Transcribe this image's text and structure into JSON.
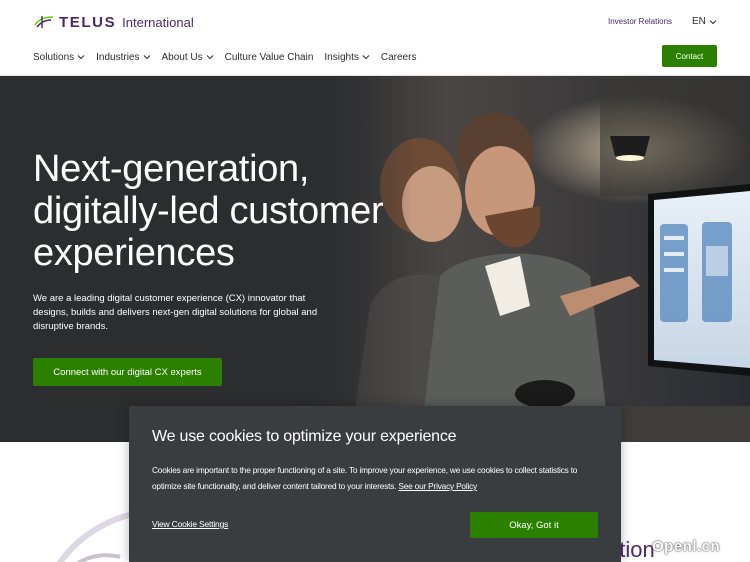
{
  "header": {
    "logo_brand": "TELUS",
    "logo_sub": "International",
    "investor_relations": "Investor Relations",
    "language": "EN",
    "contact_label": "Contact"
  },
  "nav": {
    "items": [
      {
        "label": "Solutions",
        "has_dropdown": true
      },
      {
        "label": "Industries",
        "has_dropdown": true
      },
      {
        "label": "About Us",
        "has_dropdown": true
      },
      {
        "label": "Culture Value Chain",
        "has_dropdown": false
      },
      {
        "label": "Insights",
        "has_dropdown": true
      },
      {
        "label": "Careers",
        "has_dropdown": false
      }
    ]
  },
  "hero": {
    "title_line1": "Next-generation,",
    "title_line2": "digitally-led customer",
    "title_line3": "experiences",
    "description": "We are a leading digital customer experience (CX) innovator that designs, builds and delivers next-gen digital solutions for global and disruptive brands.",
    "cta_label": "Connect with our digital CX experts"
  },
  "below": {
    "partial_heading": "vation"
  },
  "cookie": {
    "title": "We use cookies to optimize your experience",
    "body": "Cookies are important to the proper functioning of a site. To improve your experience, we use cookies to collect statistics to optimize site functionality, and deliver content tailored to your interests.",
    "policy_link": "See our Privacy Policy",
    "settings_label": "View Cookie Settings",
    "accept_label": "Okay, Got it"
  },
  "watermark": "Openl.cn",
  "colors": {
    "brand_purple": "#4b286d",
    "brand_green": "#2b8000",
    "cookie_bg": "#3a3d40"
  }
}
